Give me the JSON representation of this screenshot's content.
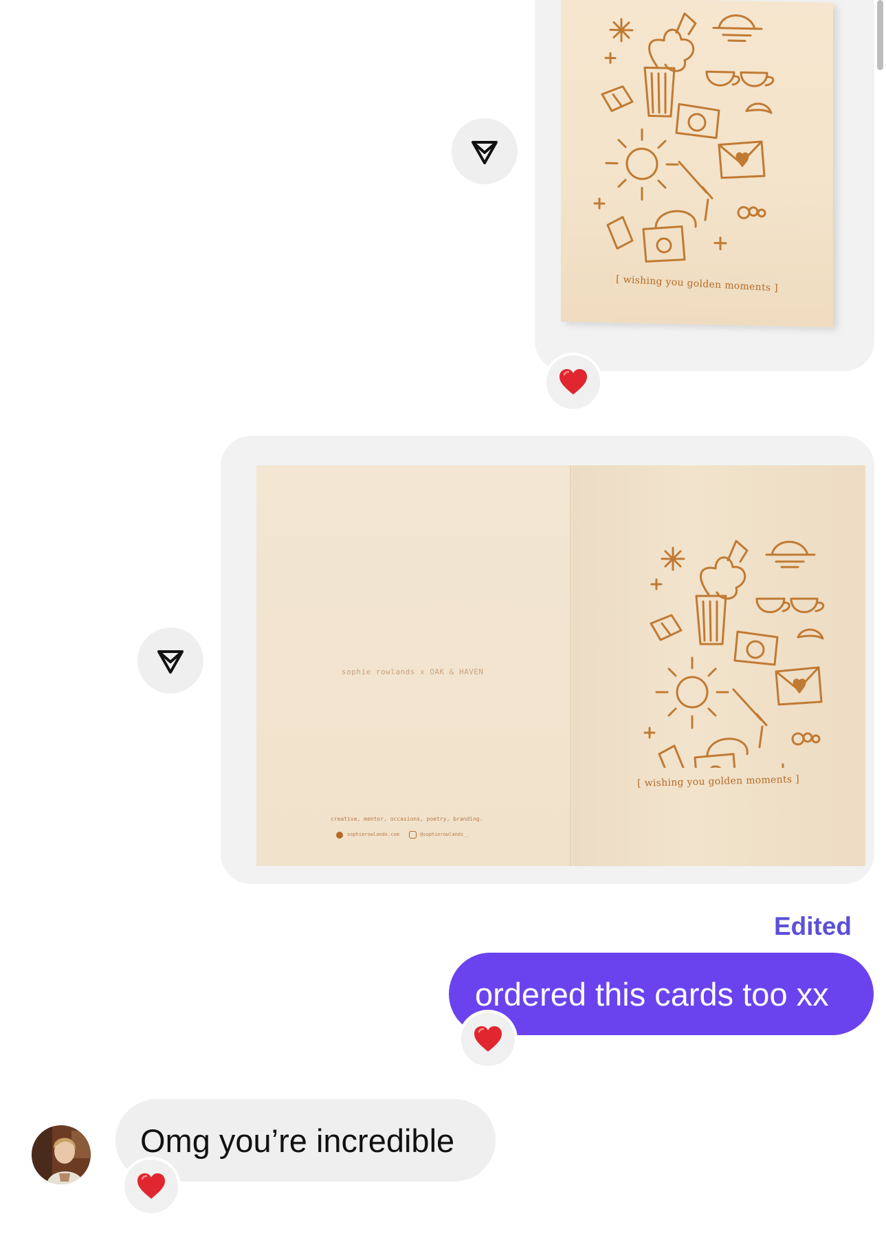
{
  "conversation": {
    "media_1": {
      "card_caption": "[ wishing you golden moments ]"
    },
    "media_2": {
      "card_caption": "[ wishing you golden moments ]",
      "back_brand": "sophie rowlands x OAK & HAVEN",
      "back_tagline": "creative, mentor, occasions, poetry, branding.",
      "back_website": "sophierowlands.com",
      "back_handle": "@sophierowlands__"
    },
    "sent_message": {
      "status": "Edited",
      "text": "ordered this cards too xx"
    },
    "received_message": {
      "text": "Omg you’re incredible"
    },
    "reaction_emoji": "heart",
    "colors": {
      "sent_bubble": "#6a43ef",
      "edited_label": "#5b50d6",
      "received_bubble": "#efefef",
      "card_ink": "#b56a25",
      "heart": "#e0262e"
    }
  }
}
